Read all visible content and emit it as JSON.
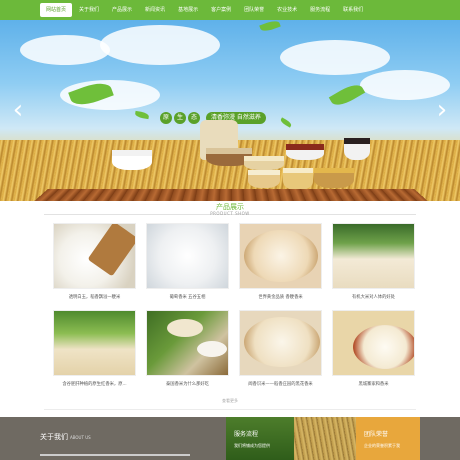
{
  "nav": {
    "items": [
      "网站首页",
      "关于我们",
      "产品展示",
      "新闻资讯",
      "基地展示",
      "客户案例",
      "团队荣誉",
      "农业技术",
      "服务流程",
      "联系我们"
    ],
    "active_index": 0
  },
  "banner": {
    "slogan_chars": [
      "原",
      "生",
      "态"
    ],
    "slogan_text": "清香弥漫 自然滋养",
    "prev_icon": "chevron-left-icon",
    "next_icon": "chevron-right-icon"
  },
  "products": {
    "title": "产品展示",
    "subtitle": "PRODUCT SHOW",
    "items": [
      {
        "caption": "透明白玉，稻香飘溢一粳米"
      },
      {
        "caption": "葡萄香米 五谷五相"
      },
      {
        "caption": "世界黄金品质 香粳香米"
      },
      {
        "caption": "有机大米对人体的好处"
      },
      {
        "caption": "含谷胚肝种植的原生红香米，原..."
      },
      {
        "caption": "泰国香米为什么那好吃"
      },
      {
        "caption": "闻香识米——稻香庄园的黑花香米"
      },
      {
        "caption": "黑城寨家和香米"
      }
    ],
    "more_label": "查看更多"
  },
  "bottom": {
    "about_title": "关于我们",
    "about_sub": "ABOUT US",
    "panel1_title": "服务流程",
    "panel1_text": "我们将铺成为您提供",
    "panel2_title": "团队荣誉",
    "panel2_text": "企业的荣誉积累于我"
  },
  "colors": {
    "brand_green": "#6cb93a",
    "panel_orange": "#e8a73c"
  }
}
